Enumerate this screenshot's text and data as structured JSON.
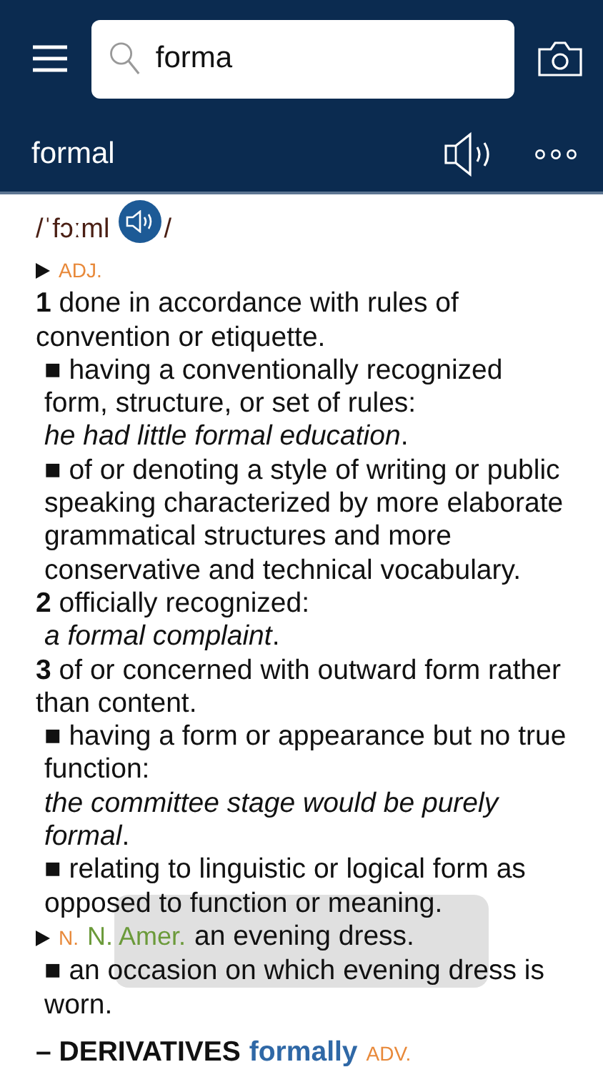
{
  "search": {
    "value": "forma"
  },
  "headword": "formal",
  "pronunciation": {
    "before": "/ˈfɔːml",
    "after": "/"
  },
  "blocks": [
    {
      "kind": "pos",
      "label": "ADJ."
    },
    {
      "kind": "sense",
      "number": "1",
      "text": "done in accordance with rules of convention or etiquette."
    },
    {
      "kind": "subsense",
      "text": "■ having a conventionally recognized form, structure, or set of rules:"
    },
    {
      "kind": "example",
      "text": "*he had little formal education*."
    },
    {
      "kind": "subsense",
      "text": "■ of or denoting a style of writing or public speaking characterized by more elaborate grammatical structures and more conservative and technical vocabulary."
    },
    {
      "kind": "sense",
      "number": "2",
      "text": "officially recognized:"
    },
    {
      "kind": "example",
      "text": "*a formal complaint*."
    },
    {
      "kind": "sense",
      "number": "3",
      "text": "of or concerned with outward form rather than content."
    },
    {
      "kind": "subsense",
      "text": "■ having a form or appearance but no true function:"
    },
    {
      "kind": "example",
      "text": "*the committee stage would be purely formal*."
    },
    {
      "kind": "subsense",
      "text": "■ relating to linguistic or logical form as opposed to function or meaning."
    },
    {
      "kind": "pos",
      "label": "N.",
      "region": "N. Amer.",
      "text": "an evening dress."
    },
    {
      "kind": "subsense",
      "text": "■ an occasion on which evening dress is worn."
    },
    {
      "kind": "derivatives",
      "label": "– DERIVATIVES",
      "word": "formally",
      "pos": "ADV."
    }
  ],
  "toast": {
    "kind": "overlay"
  }
}
